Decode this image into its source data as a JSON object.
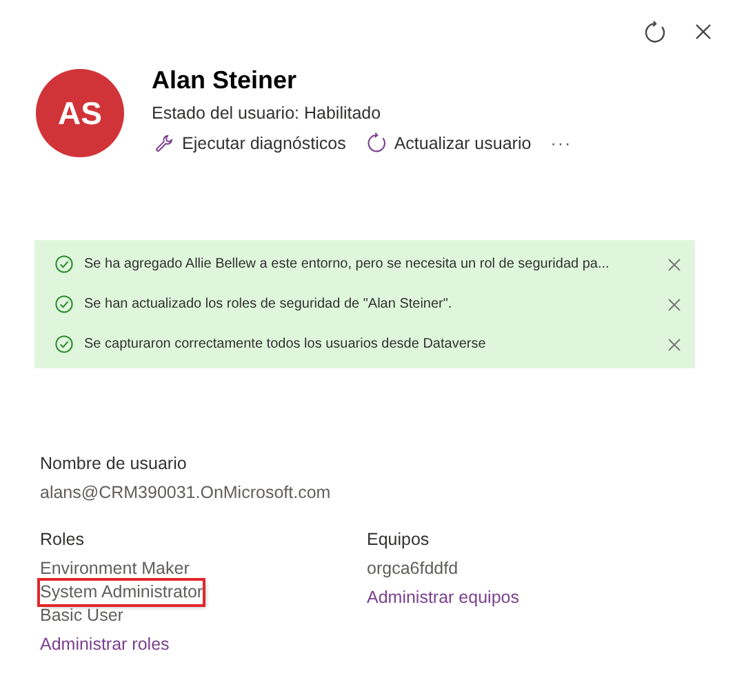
{
  "header_actions": [
    {
      "kind": "refresh"
    },
    {
      "kind": "close"
    }
  ],
  "user": {
    "initials": "AS",
    "name": "Alan Steiner",
    "status": "Estado del usuario: Habilitado"
  },
  "actions": [
    {
      "kind": "diagnose",
      "label": "Ejecutar diagnósticos"
    },
    {
      "kind": "refresh",
      "label": "Actualizar usuario"
    },
    {
      "kind": "more",
      "label": "···"
    }
  ],
  "notifications": [
    {
      "text": "Se ha agregado Allie Bellew a este entorno, pero se necesita un rol de seguridad pa..."
    },
    {
      "text": "Se han actualizado los roles de seguridad de \"Alan Steiner\"."
    },
    {
      "text": "Se capturaron correctamente todos los usuarios desde Dataverse"
    }
  ],
  "username": {
    "label": "Nombre de usuario",
    "value": "alans@CRM390031.OnMicrosoft.com"
  },
  "roles": {
    "label": "Roles",
    "items": [
      {
        "name": "Environment Maker",
        "highlighted": false
      },
      {
        "name": "System Administrator",
        "highlighted": true
      },
      {
        "name": "Basic User",
        "highlighted": false
      }
    ],
    "link": "Administrar roles"
  },
  "teams": {
    "label": "Equipos",
    "items": [
      "orgca6fddfd"
    ],
    "link": "Administrar equipos"
  }
}
